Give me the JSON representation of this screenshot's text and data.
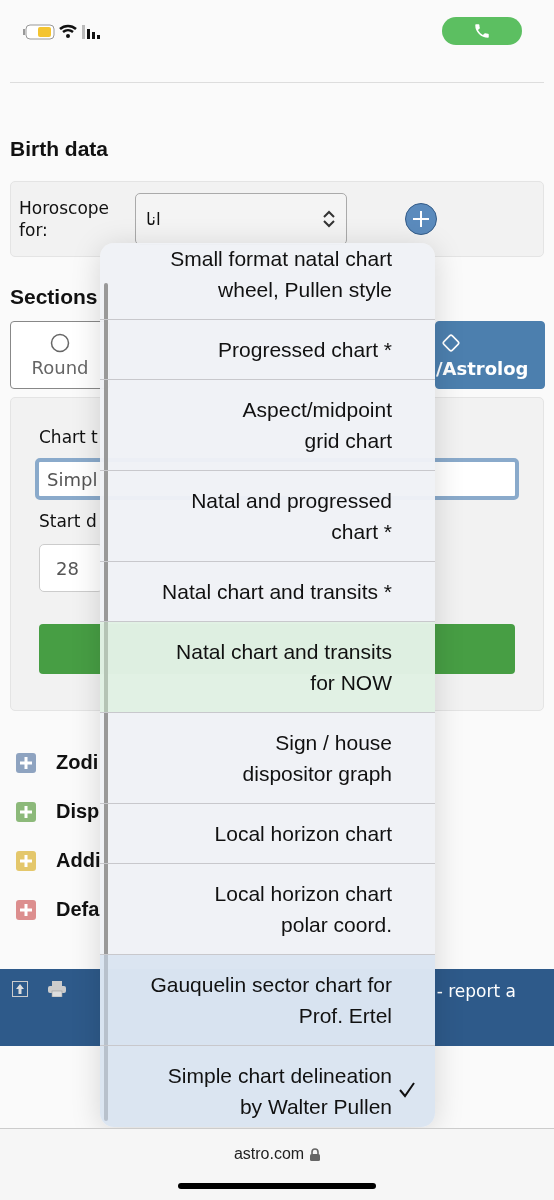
{
  "page": {
    "birth_data": {
      "heading": "Birth data",
      "label": "Horoscope for:",
      "select_value": "انا"
    },
    "sections": {
      "heading": "Sections",
      "tabs": [
        {
          "label": "Round",
          "kind": "circle",
          "selected": false
        },
        {
          "label": "/Astrolog",
          "kind": "diamond",
          "selected": true
        }
      ],
      "chart_type_label": "Chart t",
      "chart_type_value": "Simpl",
      "start_label": "Start d",
      "start_day": "28"
    },
    "accordion": [
      {
        "label": "Zodi",
        "color": "#8ea3c0"
      },
      {
        "label": "Disp",
        "color": "#8cb97a"
      },
      {
        "label": "Addi",
        "color": "#e4c76b"
      },
      {
        "label": "Defa",
        "color": "#dc8e8e"
      }
    ],
    "footer": {
      "text": "- report a"
    }
  },
  "menu": {
    "items": [
      {
        "label": "Small format natal chart\nwheel, Pullen style",
        "selected": false
      },
      {
        "label": "Progressed chart *",
        "selected": false
      },
      {
        "label": "Aspect/midpoint\ngrid chart",
        "selected": false
      },
      {
        "label": "Natal and progressed\nchart *",
        "selected": false
      },
      {
        "label": "Natal chart and transits *",
        "selected": false
      },
      {
        "label": "Natal chart and transits\nfor NOW",
        "selected": false
      },
      {
        "label": "Sign / house\ndispositor graph",
        "selected": false
      },
      {
        "label": "Local horizon chart",
        "selected": false
      },
      {
        "label": "Local horizon chart\npolar coord.",
        "selected": false
      },
      {
        "label": "Gauquelin sector chart for\nProf. Ertel",
        "selected": false
      },
      {
        "label": "Simple chart delineation\nby Walter Pullen",
        "selected": true
      }
    ]
  },
  "address_bar": {
    "url": "astro.com"
  }
}
